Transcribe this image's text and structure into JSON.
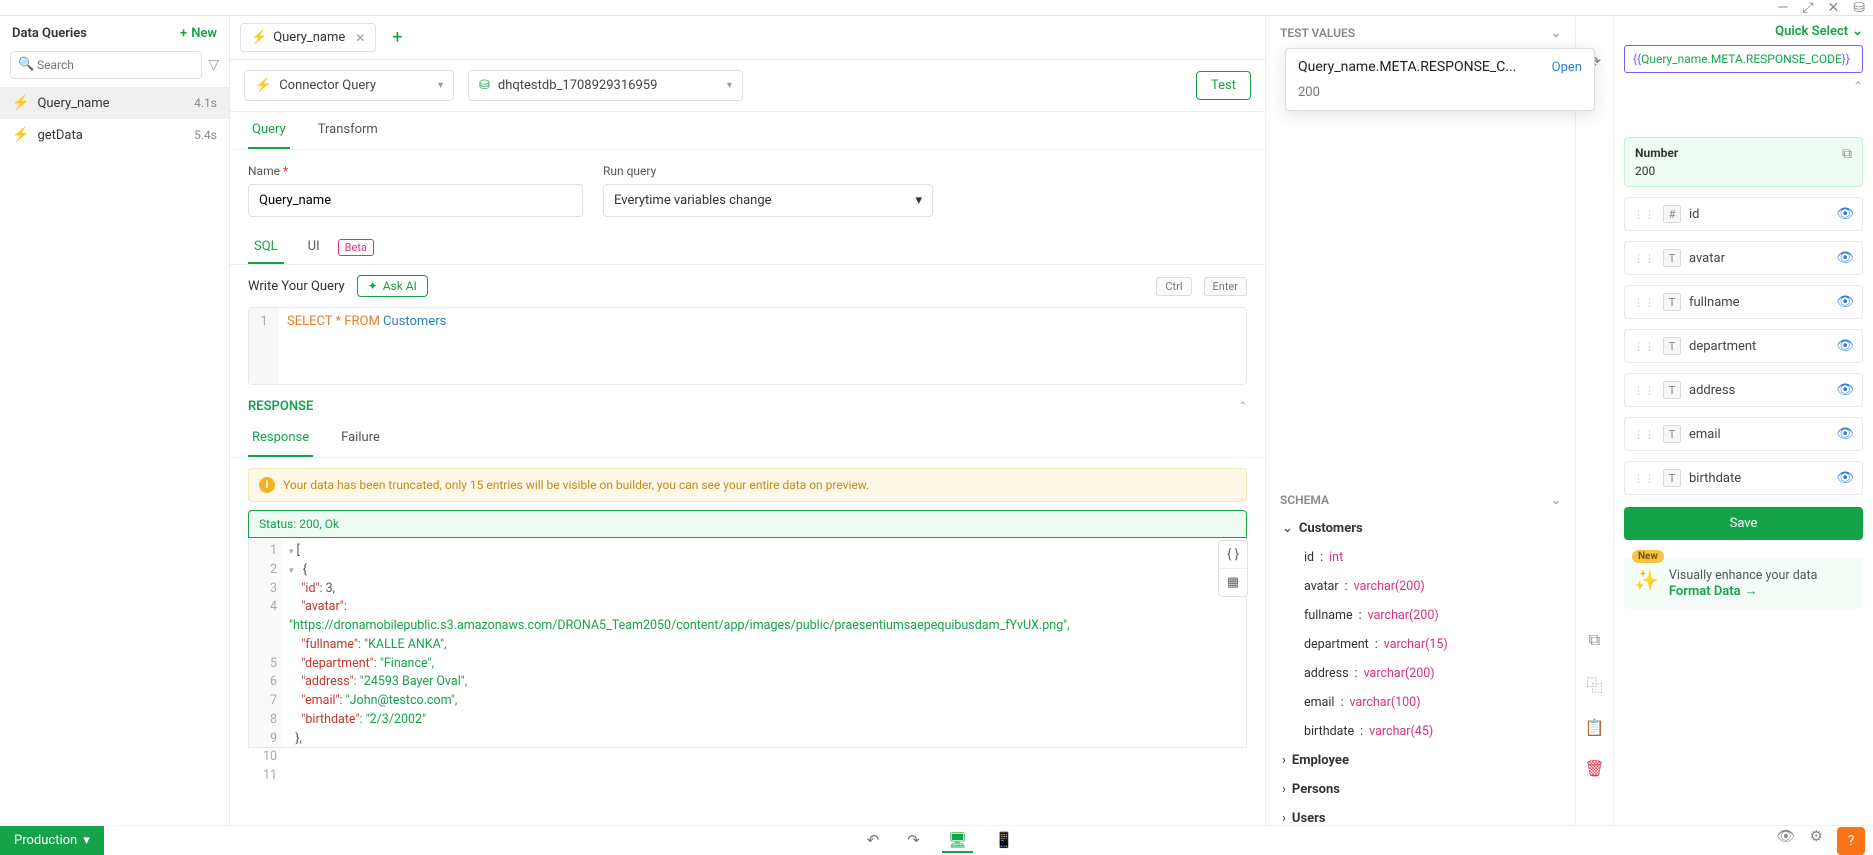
{
  "topbar": {
    "minimize": "—",
    "expand": "⤢",
    "close": "✕",
    "db": "⛁"
  },
  "sidebar": {
    "title": "Data Queries",
    "new_label": "New",
    "search_placeholder": "Search",
    "items": [
      {
        "name": "Query_name",
        "time": "4.1s"
      },
      {
        "name": "getData",
        "time": "5.4s"
      }
    ]
  },
  "tabs": {
    "open": [
      {
        "label": "Query_name"
      }
    ]
  },
  "connector": {
    "type_label": "Connector Query",
    "db_label": "dhqtestdb_1708929316959",
    "test_label": "Test"
  },
  "qtabs": {
    "query": "Query",
    "transform": "Transform"
  },
  "form": {
    "name_label": "Name",
    "name_value": "Query_name",
    "run_label": "Run query",
    "run_value": "Everytime variables change"
  },
  "sqltabs": {
    "sql": "SQL",
    "ui": "UI",
    "beta": "Beta"
  },
  "writeq": {
    "label": "Write Your Query",
    "askai": "Ask AI",
    "k1": "Ctrl",
    "k2": "Enter"
  },
  "code": {
    "kw": "SELECT * FROM ",
    "tbl": "Customers"
  },
  "response": {
    "head": "RESPONSE",
    "tab_resp": "Response",
    "tab_fail": "Failure",
    "alert": "Your data has been truncated, only 15 entries will be visible on builder, you can see your entire data on preview.",
    "status": "Status:  200, Ok",
    "json_lines": {
      "l1": "[",
      "l2": "  {",
      "l3_k": "\"id\"",
      "l3_v": ": 3,",
      "l4_k": "\"avatar\"",
      "l4_v": ":",
      "l4b": "\"https://dronamobilepublic.s3.amazonaws.com/DRONA5_Team2050/content/app/images/public/praesentiumsaepequibusdam_fYvUX.png\",",
      "l5_k": "\"fullname\"",
      "l5_v": ": \"KALLE ANKA\",",
      "l6_k": "\"department\"",
      "l6_v": ": \"Finance\",",
      "l7_k": "\"address\"",
      "l7_v": ": \"24593 Bayer Oval\",",
      "l8_k": "\"email\"",
      "l8_v": ": \"John@testco.com\",",
      "l9_k": "\"birthdate\"",
      "l9_v": ": \"2/3/2002\"",
      "l10": "  },",
      "l11": "  {"
    }
  },
  "tvalues": {
    "title": "TEST VALUES"
  },
  "schema": {
    "title": "SCHEMA",
    "tables": [
      {
        "name": "Customers",
        "open": true,
        "cols": [
          {
            "n": "id",
            "t": "int"
          },
          {
            "n": "avatar",
            "t": "varchar(200)"
          },
          {
            "n": "fullname",
            "t": "varchar(200)"
          },
          {
            "n": "department",
            "t": "varchar(15)"
          },
          {
            "n": "address",
            "t": "varchar(200)"
          },
          {
            "n": "email",
            "t": "varchar(100)"
          },
          {
            "n": "birthdate",
            "t": "varchar(45)"
          }
        ]
      },
      {
        "name": "Employee"
      },
      {
        "name": "Persons"
      },
      {
        "name": "Users"
      }
    ]
  },
  "farright": {
    "quick_select": "Quick Select",
    "expr_inner": "Query_name.META.RESPONSE_CODE",
    "popover_title": "Query_name.META.RESPONSE_C...",
    "popover_open": "Open",
    "popover_val": "200",
    "numlabel": "Number",
    "numval": "200",
    "fields": [
      {
        "icon": "#",
        "label": "id"
      },
      {
        "icon": "T",
        "label": "avatar"
      },
      {
        "icon": "T",
        "label": "fullname"
      },
      {
        "icon": "T",
        "label": "department"
      },
      {
        "icon": "T",
        "label": "address"
      },
      {
        "icon": "T",
        "label": "email"
      },
      {
        "icon": "T",
        "label": "birthdate"
      }
    ],
    "save": "Save",
    "vis_badge": "New",
    "vis_text": "Visually enhance your data",
    "vis_link": "Format Data"
  },
  "bottom": {
    "prod": "Production"
  }
}
